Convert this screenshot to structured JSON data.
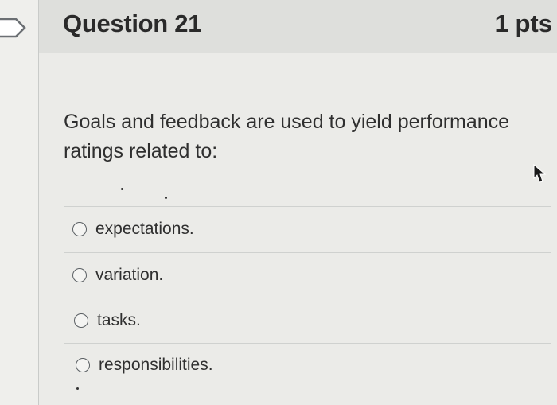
{
  "header": {
    "title": "Question 21",
    "points": "1 pts"
  },
  "question": {
    "text": "Goals and feedback are used to yield performance ratings related to:"
  },
  "answers": [
    {
      "label": "expectations."
    },
    {
      "label": "variation."
    },
    {
      "label": "tasks."
    },
    {
      "label": "responsibilities."
    }
  ],
  "icons": {
    "flag": "bookmark-flag-icon",
    "cursor": "mouse-pointer-icon"
  }
}
